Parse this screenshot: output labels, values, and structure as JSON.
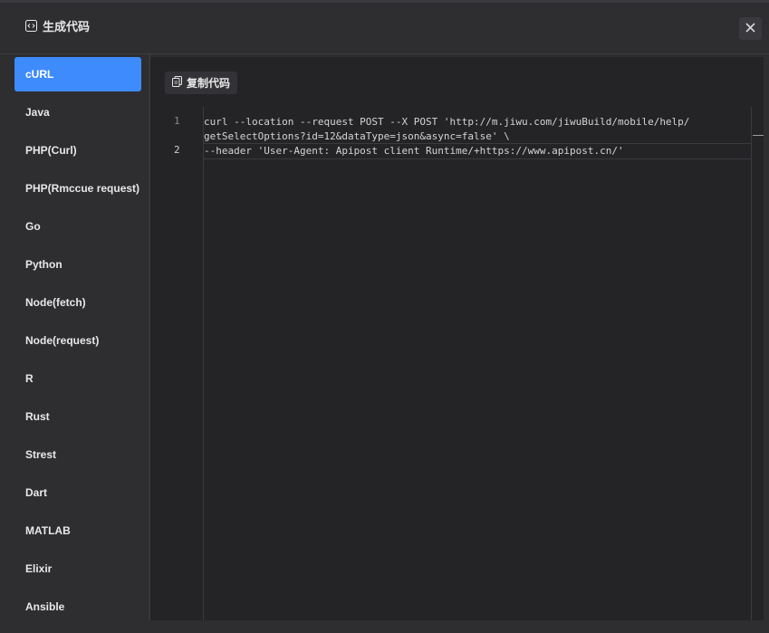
{
  "dialog": {
    "title": "生成代码",
    "close_icon": "close-icon",
    "title_icon": "code-icon"
  },
  "sidebar": {
    "active_index": 0,
    "items": [
      {
        "label": "cURL"
      },
      {
        "label": "Java"
      },
      {
        "label": "PHP(Curl)"
      },
      {
        "label": "PHP(Rmccue request)"
      },
      {
        "label": "Go"
      },
      {
        "label": "Python"
      },
      {
        "label": "Node(fetch)"
      },
      {
        "label": "Node(request)"
      },
      {
        "label": "R"
      },
      {
        "label": "Rust"
      },
      {
        "label": "Strest"
      },
      {
        "label": "Dart"
      },
      {
        "label": "MATLAB"
      },
      {
        "label": "Elixir"
      },
      {
        "label": "Ansible"
      }
    ]
  },
  "toolbar": {
    "copy_label": "复制代码",
    "copy_icon": "copy-icon"
  },
  "editor": {
    "lines": [
      {
        "number": "1",
        "text": "curl --location --request POST --X POST 'http://m.jiwu.com/jiwuBuild/mobile/help/"
      },
      {
        "number": "",
        "text": "getSelectOptions?id=12&dataType=json&async=false' \\"
      },
      {
        "number": "2",
        "text": "--header 'User-Agent: Apipost client Runtime/+https://www.apipost.cn/'"
      }
    ]
  },
  "colors": {
    "accent": "#3d8bfd",
    "background": "#2e2e31",
    "editor_bg": "#242427"
  }
}
